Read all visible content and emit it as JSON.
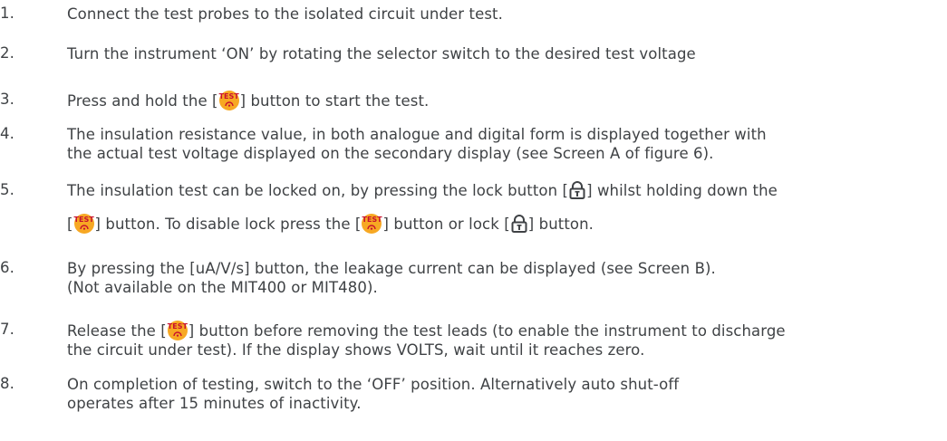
{
  "steps": [
    {
      "num": "1.",
      "lines": [
        "Connect the test probes to the isolated circuit under test."
      ]
    },
    {
      "num": "2.",
      "lines": [
        "Turn the instrument ‘ON’ by rotating the selector switch to the desired test voltage"
      ]
    },
    {
      "num": "3.",
      "parts": [
        "Press and hold the [",
        "] button to start the test."
      ]
    },
    {
      "num": "4.",
      "lines": [
        "The insulation resistance value, in both analogue and digital form is displayed together with",
        "the actual test voltage displayed on the secondary display (see Screen A of figure 6)."
      ]
    },
    {
      "num": "5.",
      "line1": [
        "The insulation test can be locked on, by pressing the lock button [",
        "] whilst holding down the"
      ],
      "line2": [
        "[",
        "] button. To disable lock press the [",
        "] button or lock [",
        "] button."
      ]
    },
    {
      "num": "6.",
      "lines": [
        "By pressing the [uA/V/s] button, the leakage current can be displayed (see Screen B).",
        "(Not available on the MIT400 or MIT480)."
      ]
    },
    {
      "num": "7.",
      "line1": [
        "Release the [",
        "] button before removing the test leads (to enable the instrument to discharge"
      ],
      "line2": "the circuit under test). If the display shows VOLTS, wait until it reaches zero."
    },
    {
      "num": "8.",
      "lines": [
        "On completion of testing, switch to the ‘OFF’ position. Alternatively auto shut-off",
        "operates after 15 minutes of inactivity."
      ]
    }
  ],
  "test_button_label": "TEST",
  "icons": {
    "test": "test-button-icon",
    "lock": "lock-icon"
  },
  "colors": {
    "text": "#3f4245",
    "test_button_bg": "#f7a823",
    "test_button_text": "#c8102e"
  }
}
